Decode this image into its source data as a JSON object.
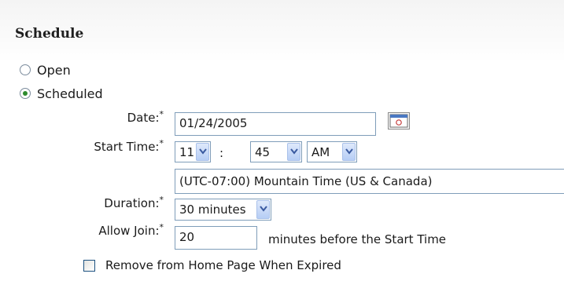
{
  "schedule": {
    "title": "Schedule",
    "options": [
      {
        "label": "Open",
        "selected": false
      },
      {
        "label": "Scheduled",
        "selected": true
      }
    ],
    "date": {
      "label": "Date:",
      "required_mark": "*",
      "value": "01/24/2005",
      "calendar_icon": "calendar-icon"
    },
    "start_time": {
      "label": "Start Time:",
      "required_mark": "*",
      "hour": "11",
      "separator": ":",
      "minute": "45",
      "ampm": "AM",
      "timezone": "(UTC-07:00) Mountain Time (US & Canada)"
    },
    "duration": {
      "label": "Duration:",
      "required_mark": "*",
      "value": "30 minutes"
    },
    "allow_join": {
      "label": "Allow Join:",
      "required_mark": "*",
      "value": "20",
      "suffix": "minutes before the Start Time"
    },
    "remove_expired": {
      "label": "Remove from Home Page When Expired",
      "checked": false
    }
  },
  "colors": {
    "border": "#7f9db9",
    "radio_dot": "#2e8b2e",
    "dropdown_button": "#b6cdf5"
  }
}
